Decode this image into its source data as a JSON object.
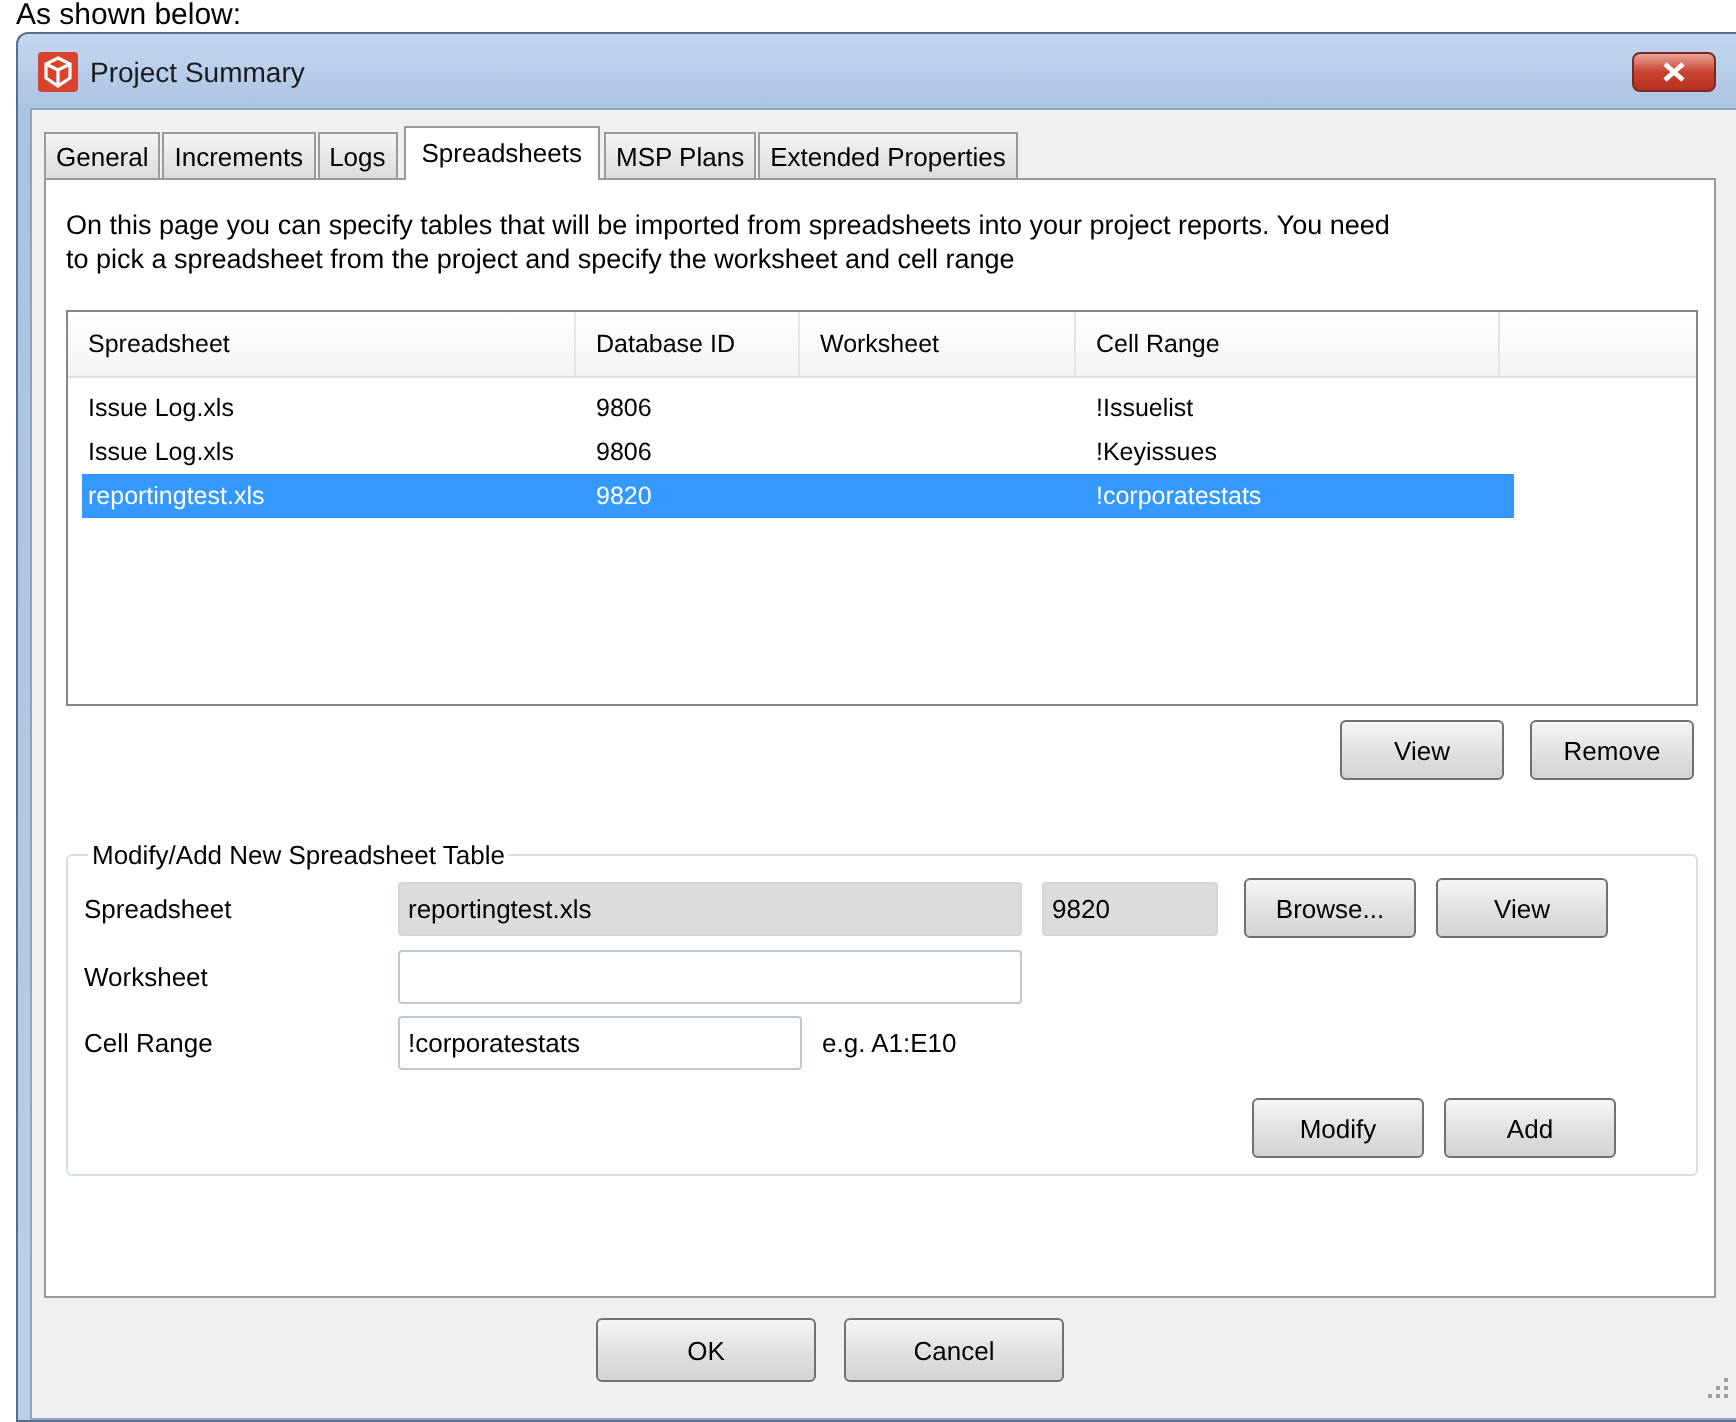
{
  "page_caption": "As shown below:",
  "window": {
    "title": "Project Summary"
  },
  "tabs": [
    {
      "label": "General",
      "selected": false
    },
    {
      "label": "Increments",
      "selected": false
    },
    {
      "label": "Logs",
      "selected": false
    },
    {
      "label": "Spreadsheets",
      "selected": true
    },
    {
      "label": "MSP Plans",
      "selected": false
    },
    {
      "label": "Extended Properties",
      "selected": false
    }
  ],
  "description": "On this page you can specify tables that will be imported from spreadsheets into your project reports.  You need to pick a spreadsheet from the project and specify the worksheet and cell range",
  "table": {
    "columns": [
      "Spreadsheet",
      "Database ID",
      "Worksheet",
      "Cell Range"
    ],
    "rows": [
      {
        "cells": [
          "Issue Log.xls",
          "9806",
          "",
          "!Issuelist"
        ],
        "selected": false
      },
      {
        "cells": [
          "Issue Log.xls",
          "9806",
          "",
          "!Keyissues"
        ],
        "selected": false
      },
      {
        "cells": [
          "reportingtest.xls",
          "9820",
          "",
          "!corporatestats"
        ],
        "selected": true
      }
    ]
  },
  "table_buttons": [
    "View",
    "Remove"
  ],
  "editor": {
    "title": "Modify/Add New Spreadsheet Table",
    "spreadsheet": {
      "label": "Spreadsheet",
      "value": "reportingtest.xls",
      "read_only": true,
      "database_id": "9820",
      "buttons": [
        "Browse...",
        "View"
      ]
    },
    "worksheet": {
      "label": "Worksheet",
      "read_only": false
    },
    "cell_range": {
      "label": "Cell Range",
      "value": "!corporatestats",
      "read_only": false,
      "hint": "e.g. A1:E10"
    },
    "buttons": [
      "Modify",
      "Add"
    ]
  },
  "footer_buttons": [
    "OK",
    "Cancel"
  ]
}
